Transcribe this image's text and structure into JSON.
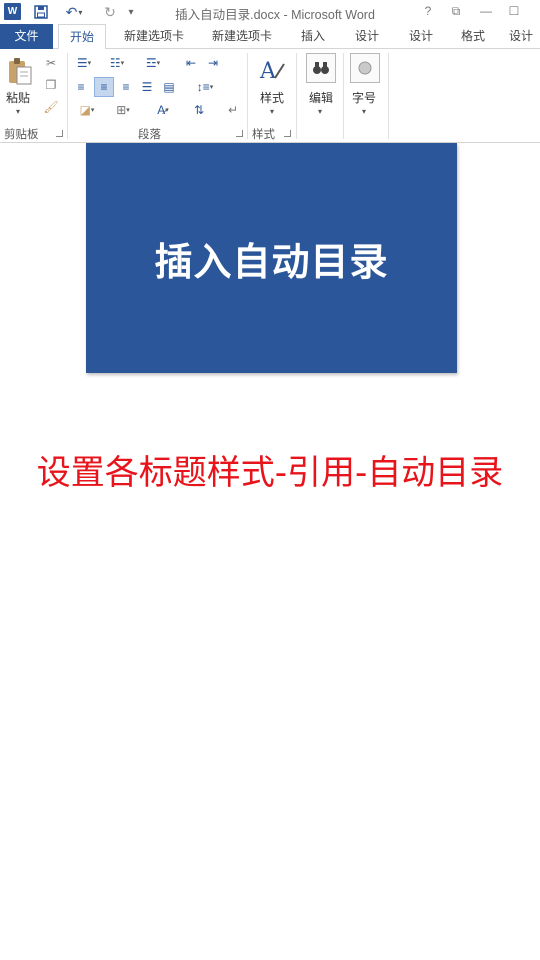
{
  "window": {
    "title": "插入自动目录.docx - Microsoft Word",
    "app_icon_letter": "W",
    "controls": {
      "help": "?",
      "restore": "⧉",
      "minimize": "—",
      "maximize": "☐"
    }
  },
  "tabs": [
    {
      "label": "文件"
    },
    {
      "label": "开始"
    },
    {
      "label": "新建选项卡"
    },
    {
      "label": "新建选项卡"
    },
    {
      "label": "插入"
    },
    {
      "label": "设计"
    },
    {
      "label": "设计"
    },
    {
      "label": "格式"
    },
    {
      "label": "设计"
    }
  ],
  "ribbon": {
    "clipboard": {
      "group_label": "剪贴板",
      "paste_label": "粘贴"
    },
    "paragraph": {
      "group_label": "段落"
    },
    "styles": {
      "group_label": "样式",
      "styles_label": "样式"
    },
    "editing": {
      "label": "编辑"
    },
    "font_number": {
      "label": "字号"
    }
  },
  "document": {
    "slide_title": "插入自动目录",
    "caption": "设置各标题样式-引用-自动目录"
  },
  "colors": {
    "accent": "#2b579a",
    "caption": "#e8141b"
  }
}
